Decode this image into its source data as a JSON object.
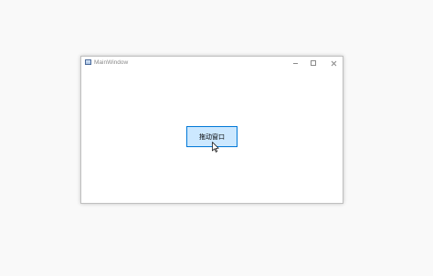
{
  "window": {
    "title": "MainWindow",
    "controls": {
      "minimize_icon": "minimize-icon",
      "maximize_icon": "maximize-icon",
      "close_icon": "close-icon"
    }
  },
  "main": {
    "drag_button_label": "拖动窗口"
  },
  "colors": {
    "desktop_bg": "#f9f9f9",
    "window_bg": "#ffffff",
    "button_bg": "#cce8ff",
    "button_border": "#0078d7",
    "title_text": "#8a8a8a"
  }
}
